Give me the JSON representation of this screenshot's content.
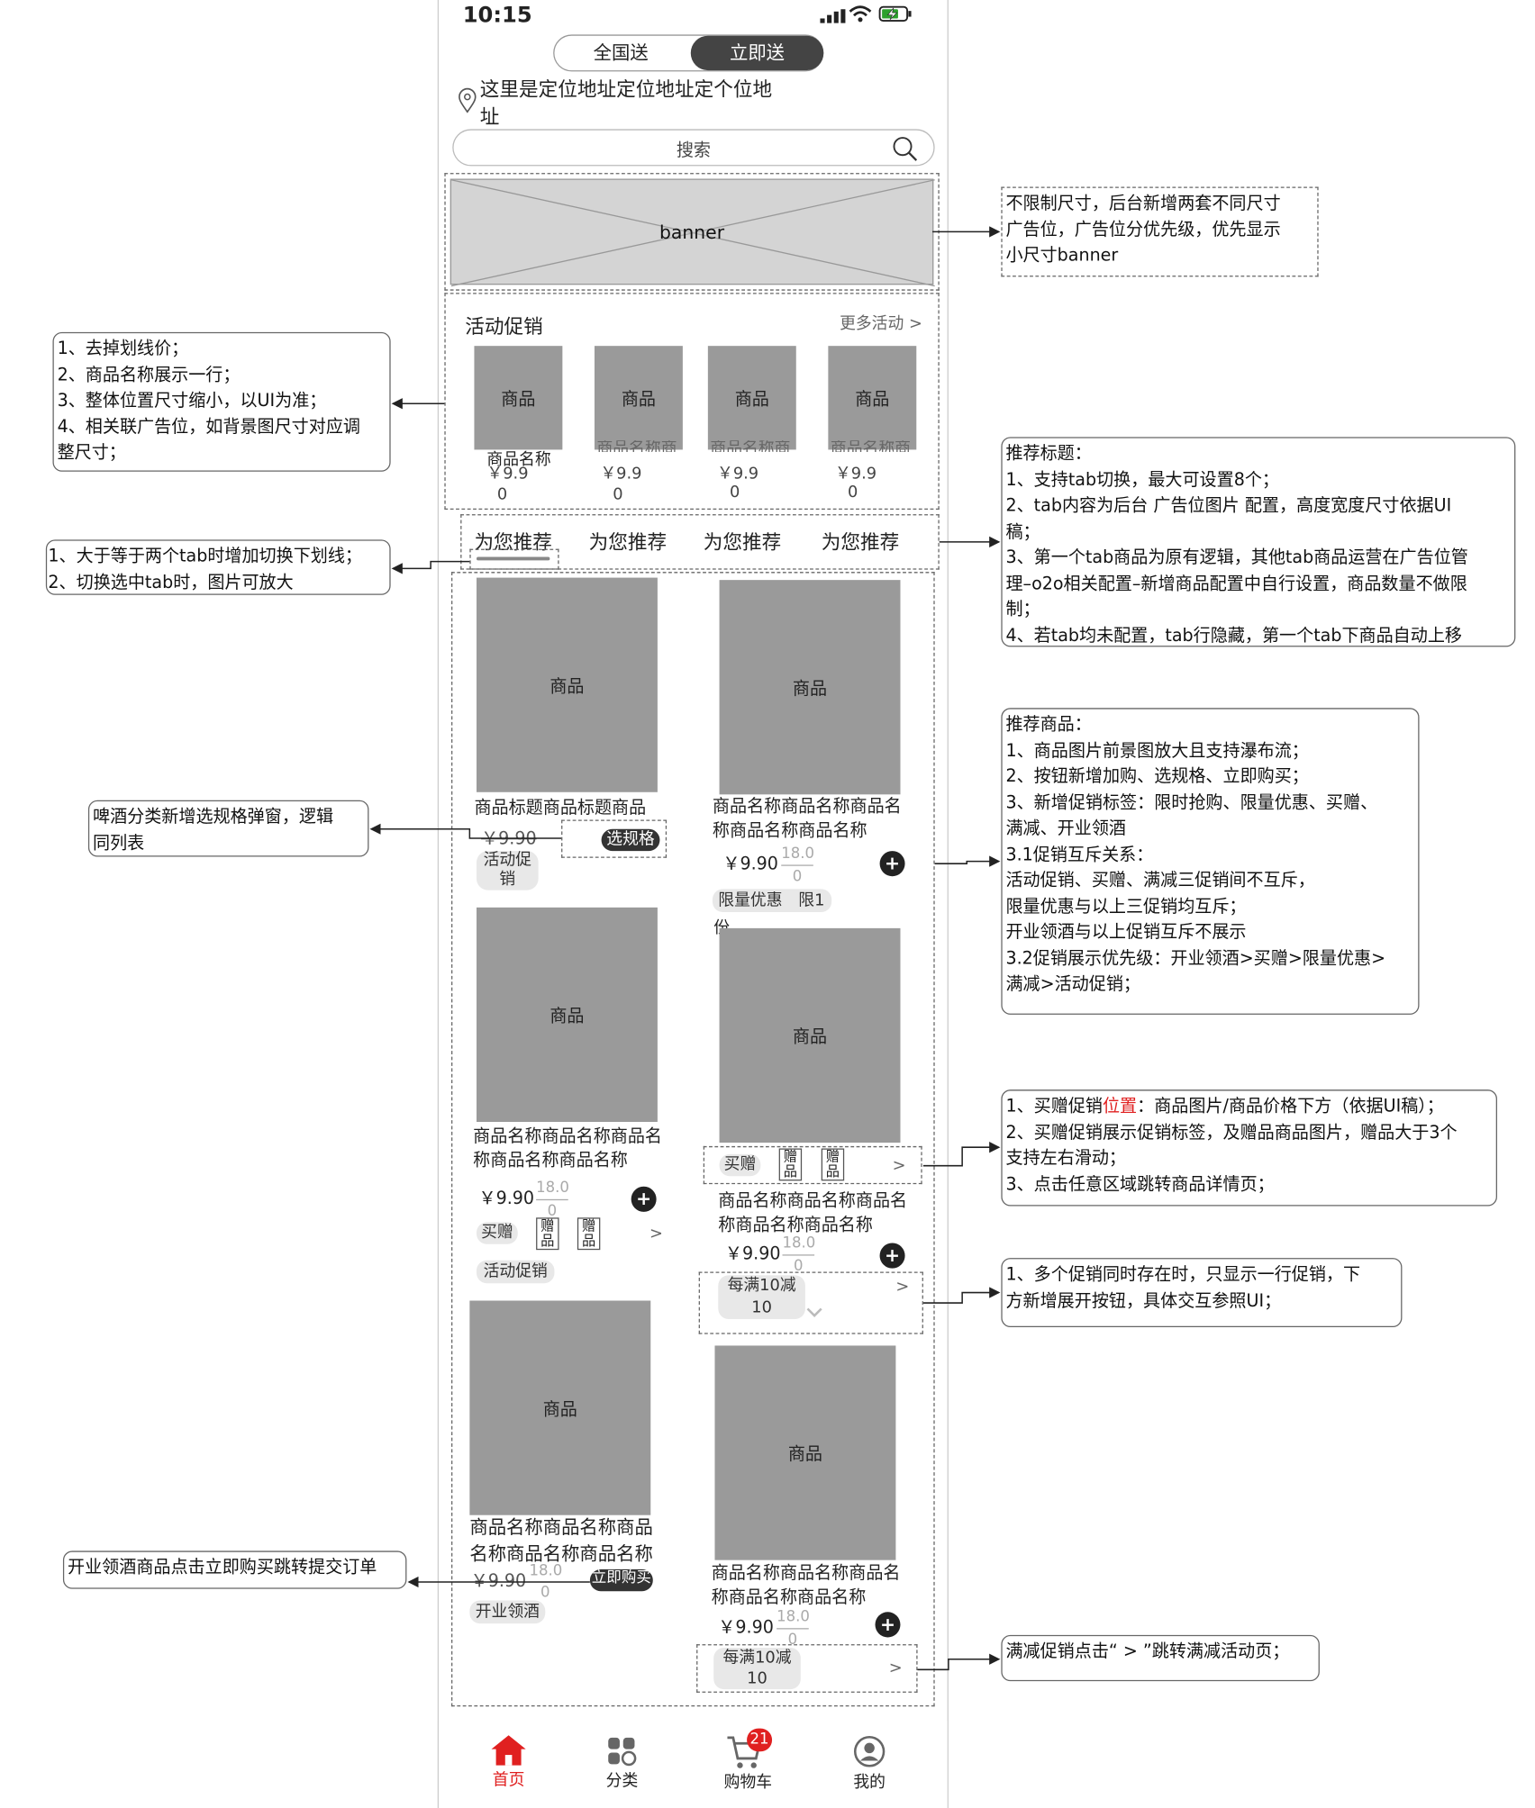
{
  "status_bar": {
    "time": "10:15"
  },
  "delivery_toggle": {
    "options": [
      "全国送",
      "立即送"
    ],
    "selected": "立即送"
  },
  "location": {
    "address_line1": "这里是定位地址定位地址定个位地",
    "address_line2": "址"
  },
  "search": {
    "placeholder": "搜索"
  },
  "banner": {
    "label": "banner"
  },
  "activity": {
    "title": "活动促销",
    "more": "更多活动 >",
    "items": [
      {
        "img": "商品",
        "name": "商品名称",
        "price": "￥9.9",
        "price2": "0"
      },
      {
        "img": "商品",
        "name": "商品名称商",
        "price": "￥9.9",
        "price2": "0"
      },
      {
        "img": "商品",
        "name": "商品名称商",
        "price": "￥9.9",
        "price2": "0"
      },
      {
        "img": "商品",
        "name": "商品名称商",
        "price": "￥9.9",
        "price2": "0"
      }
    ]
  },
  "tabs": [
    "为您推荐",
    "为您推荐",
    "为您推荐",
    "为您推荐"
  ],
  "products": {
    "p1": {
      "img": "商品",
      "name": "商品标题商品标题商品",
      "price": "￥9.90",
      "button": "选规格",
      "tag1": "活动促",
      "tag2": "销"
    },
    "p2": {
      "img": "商品",
      "name1": "商品名称商品名称商品名",
      "name2": "称商品名称商品名称",
      "price": "￥9.90",
      "strike1": "18.0",
      "strike2": "0",
      "tag": "限量优惠　限1",
      "tag2": "份"
    },
    "p3": {
      "img": "商品",
      "name1": "商品名称商品名称商品名",
      "name2": "称商品名称商品名称",
      "price": "￥9.90",
      "strike1": "18.0",
      "strike2": "0",
      "gift_tag": "买赠",
      "gift_item": "赠品",
      "tag": "活动促销"
    },
    "p4": {
      "img": "商品",
      "gift_tag": "买赠",
      "gift_item": "赠品",
      "name1": "商品名称商品名称商品名",
      "name2": "称商品名称商品名称",
      "price": "￥9.90",
      "strike1": "18.0",
      "strike2": "0",
      "tag1": "每满10减",
      "tag2": "10"
    },
    "p5": {
      "img": "商品",
      "name1": "商品名称商品名称商品",
      "name2": "名称商品名称商品名称",
      "price": "￥9.90",
      "strike1": "18.0",
      "strike2": "0",
      "button": "立即购买",
      "tag": "开业领酒"
    },
    "p6": {
      "img": "商品",
      "name1": "商品名称商品名称商品名",
      "name2": "称商品名称商品名称",
      "price": "￥9.90",
      "strike1": "18.0",
      "strike2": "0",
      "tag1": "每满10减",
      "tag2": "10"
    }
  },
  "bottom_nav": {
    "items": [
      "首页",
      "分类",
      "购物车",
      "我的"
    ],
    "cart_badge": "21",
    "active": "首页"
  },
  "notes": {
    "banner": [
      "不限制尺寸，后台新增两套不同尺寸",
      "广告位，广告位分优先级，优先显示",
      "小尺寸banner"
    ],
    "activity": [
      "1、去掉划线价；",
      "2、商品名称展示一行；",
      "3、整体位置尺寸缩小，以UI为准；",
      "4、相关联广告位，如背景图尺寸对应调",
      "整尺寸；"
    ],
    "tabs_left": [
      "1、大于等于两个tab时增加切换下划线；",
      "2、切换选中tab时，图片可放大"
    ],
    "tabs_right": [
      "推荐标题：",
      "1、支持tab切换，最大可设置8个；",
      "2、tab内容为后台 广告位图片 配置，高度宽度尺寸依据UI",
      "稿；",
      "3、第一个tab商品为原有逻辑，其他tab商品运营在广告位管",
      "理–o2o相关配置–新增商品配置中自行设置，商品数量不做限",
      "制；",
      "4、若tab均未配置，tab行隐藏，第一个tab下商品自动上移"
    ],
    "spec": [
      "啤酒分类新增选规格弹窗，逻辑",
      "同列表"
    ],
    "recommend": [
      "推荐商品：",
      "1、商品图片前景图放大且支持瀑布流；",
      "2、按钮新增加购、选规格、立即购买；",
      "3、新增促销标签：限时抢购、限量优惠、买赠、",
      "满减、开业领酒",
      "3.1促销互斥关系：",
      "活动促销、买赠、满减三促销间不互斥，",
      "限量优惠与以上三促销均互斥；",
      "开业领酒与以上促销互斥不展示",
      "3.2促销展示优先级：开业领酒>买赠>限量优惠>",
      "满减>活动促销；"
    ],
    "gift": {
      "line1_a": "1、买赠促销",
      "line1_red": "位置",
      "line1_b": "：商品图片/商品价格下方（依据UI稿）；",
      "line2": "2、买赠促销展示促销标签，及赠品商品图片，赠品大于3个",
      "line3": "支持左右滑动；",
      "line4": "3、点击任意区域跳转商品详情页；"
    },
    "multi": [
      "1、多个促销同时存在时，只显示一行促销，下",
      "方新增展开按钮，具体交互参照UI；"
    ],
    "open": [
      "开业领酒商品点击立即购买跳转提交订单"
    ],
    "full": [
      "满减促销点击“ > ”跳转满减活动页；"
    ]
  },
  "colors": {
    "accent": "#e02020",
    "dark": "#333333",
    "placeholder_gray": "#9a9a9a"
  }
}
